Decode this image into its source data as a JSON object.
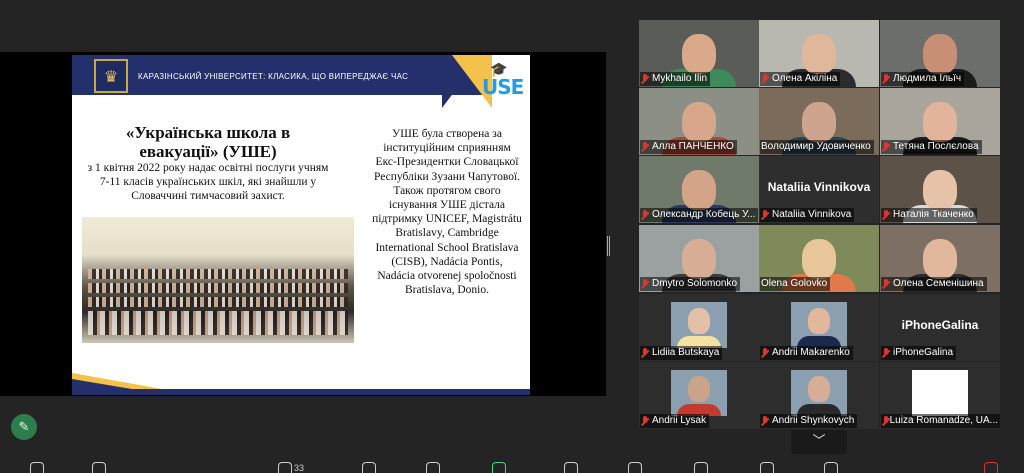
{
  "slide": {
    "university_text": "КАРАЗІНСЬКИЙ УНІВЕРСИТЕТ: КЛАСИКА, ЩО ВИПЕРЕДЖАЄ ЧАС",
    "use_logo": "USE",
    "title": "«Українська школа в евакуації» (УШЕ)",
    "subtitle": "з 1 квітня 2022 року надає освітні послуги учням 7-11 класів українських шкіл, які знайшли у Словаччині тимчасовий захист.",
    "body": "УШЕ була створена за інституційним сприянням Екс-Президентки Словацької Республіки Зузани Чапутової. Також протягом свого існування УШЕ дістала підтримку UNICEF, Magistrátu Bratislavy, Cambridge International School Bratislava (CISB), Nadácia Pontis, Nadácia otvorenej spoločnosti Bratislava, Donio."
  },
  "participants": [
    {
      "name": "Mykhailo Ilin",
      "muted": true
    },
    {
      "name": "Олена Акіліна",
      "muted": true
    },
    {
      "name": "Людмила Ільїч",
      "muted": true
    },
    {
      "name": "Алла ПАНЧЕНКО",
      "muted": true
    },
    {
      "name": "Володимир Удовиченко",
      "muted": false
    },
    {
      "name": "Тетяна Послєлова",
      "muted": true
    },
    {
      "name": "Олександр Кобець У...",
      "muted": true
    },
    {
      "name": "Nataliia Vinnikova",
      "muted": true,
      "video_off_name": "Nataliia Vinnikova"
    },
    {
      "name": "Наталія Ткаченко",
      "muted": true
    },
    {
      "name": "Dmytro Solomonko",
      "muted": true
    },
    {
      "name": "Olena Golovko",
      "muted": false,
      "active_speaker": true
    },
    {
      "name": "Олена Семенішина",
      "muted": true
    },
    {
      "name": "Lidiia Butskaya",
      "muted": true
    },
    {
      "name": "Andrii Makarenko",
      "muted": true
    },
    {
      "name": "iPhoneGalina",
      "muted": true,
      "video_off_name": "iPhoneGalina"
    },
    {
      "name": "Andrii Lysak",
      "muted": true
    },
    {
      "name": "Andrii Shynkovych",
      "muted": true
    },
    {
      "name": "Luiza Romanadze, UA...",
      "muted": true
    }
  ],
  "toolbar": {
    "participants_count": "33"
  },
  "colors": {
    "active_speaker": "#23c16b",
    "muted_icon": "#e0342f",
    "slide_navy": "#24306b",
    "slide_gold": "#f4c24a"
  }
}
